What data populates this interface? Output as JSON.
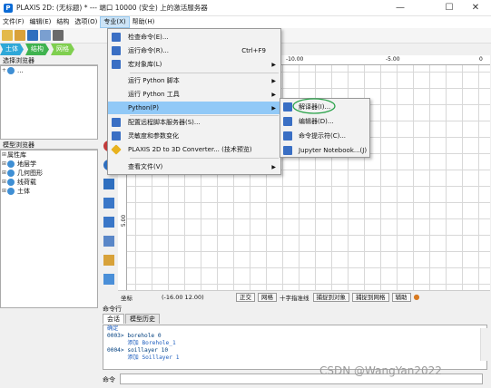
{
  "window": {
    "title": "PLAXIS 2D: (无标题) * --- 端口 10000 (安全) 上的激活服务器",
    "minimize": "—",
    "maximize": "☐",
    "close": "✕"
  },
  "menubar": [
    {
      "label": "文件(F)"
    },
    {
      "label": "编辑(E)"
    },
    {
      "label": "结构"
    },
    {
      "label": "选项(O)"
    },
    {
      "label": "专业(X)"
    },
    {
      "label": "帮助(H)"
    }
  ],
  "mode_tabs": [
    {
      "label": "土体",
      "color": "#2ea8d8"
    },
    {
      "label": "结构",
      "color": "#3fb34f"
    },
    {
      "label": "网格",
      "color": "#7fcf4f"
    }
  ],
  "selection_explorer": {
    "title": "选择浏览器",
    "items": [
      "..."
    ]
  },
  "model_explorer": {
    "title": "模型浏览器",
    "items": [
      "属性库",
      "地层学",
      "几何图形",
      "线荷载",
      "土体"
    ]
  },
  "ruler": {
    "top_labels": [
      "-10.00",
      "-5.00",
      "0"
    ],
    "left_label": "5.00"
  },
  "statusbar": {
    "coord_label": "坐标",
    "coord_value": "(-16.00 12.00)",
    "buttons": [
      "正交",
      "网格",
      "捕捉到对象",
      "捕捉到网格",
      "辅助"
    ],
    "crosshair": "十字指准线"
  },
  "command_panel": {
    "title": "命令行",
    "tabs": [
      "会话",
      "模型历史"
    ],
    "log": [
      {
        "text": "确定",
        "color": "#1f5fbf"
      },
      {
        "text": "0003> borehole 0",
        "color": "#003f7f"
      },
      {
        "text": "      添加 Borehole_1",
        "color": "#1f5fbf"
      },
      {
        "text": "0004> soillayer 10",
        "color": "#003f7f"
      },
      {
        "text": "      添加 Soillayer 1",
        "color": "#1f5fbf"
      }
    ],
    "input_label": "命令"
  },
  "expert_menu": {
    "items": [
      {
        "label": "检查命令(E)...",
        "shortcut": "",
        "arrow": "",
        "icon": "#3a6fc4"
      },
      {
        "label": "运行命令(R)...",
        "shortcut": "Ctrl+F9",
        "arrow": "",
        "icon": "#3a6fc4"
      },
      {
        "label": "宏对象库(L)",
        "shortcut": "",
        "arrow": "▶",
        "icon": "#3a6fc4"
      },
      {
        "label": "运行 Python 脚本",
        "shortcut": "",
        "arrow": "▶",
        "icon": ""
      },
      {
        "label": "运行 Python 工具",
        "shortcut": "",
        "arrow": "▶",
        "icon": ""
      },
      {
        "label": "Python(P)",
        "shortcut": "",
        "arrow": "▶",
        "icon": ""
      },
      {
        "label": "配置远程脚本服务器(S)...",
        "shortcut": "",
        "arrow": "",
        "icon": "#3a6fc4"
      },
      {
        "label": "灵敏度和参数变化",
        "shortcut": "",
        "arrow": "",
        "icon": "#3a6fc4"
      },
      {
        "label": "PLAXIS 2D to 3D Converter... (技术预览)",
        "shortcut": "",
        "arrow": "",
        "icon": "#e8b21e"
      },
      {
        "label": "查看文件(V)",
        "shortcut": "",
        "arrow": "▶",
        "icon": ""
      }
    ]
  },
  "python_submenu": {
    "items": [
      {
        "label": "解译器(I)..."
      },
      {
        "label": "编辑器(D)..."
      },
      {
        "label": "命令提示符(C)..."
      },
      {
        "label": "Jupyter Notebook...(J)"
      }
    ]
  },
  "watermark": "CSDN @WangYan2022"
}
